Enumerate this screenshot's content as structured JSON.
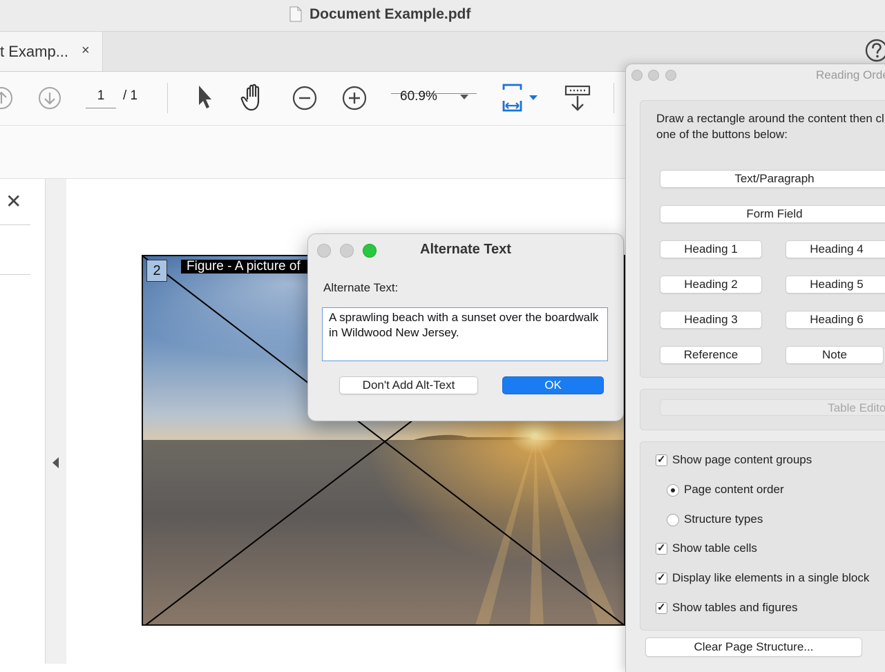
{
  "window": {
    "title": "Document Example.pdf"
  },
  "tab": {
    "label": "t Examp...",
    "close": "×"
  },
  "toolbar": {
    "page_current": "1",
    "page_total": "/ 1",
    "zoom": "60.9%"
  },
  "left_panel": {
    "close": "✕"
  },
  "figure": {
    "number": "2",
    "label": "Figure - A picture of"
  },
  "alt_dialog": {
    "title": "Alternate Text",
    "label": "Alternate Text:",
    "text": "A sprawling beach with a sunset over the boardwalk in Wildwood New Jersey.",
    "dont_add_button": "Don't Add Alt-Text",
    "ok_button": "OK"
  },
  "reading_order": {
    "title": "Reading Order",
    "instructions": "Draw a rectangle around the content then click one of the buttons below:",
    "buttons": {
      "text_paragraph": "Text/Paragraph",
      "form_field": "Form Field",
      "heading1": "Heading 1",
      "heading2": "Heading 2",
      "heading3": "Heading 3",
      "heading4": "Heading 4",
      "heading5": "Heading 5",
      "heading6": "Heading 6",
      "reference": "Reference",
      "note": "Note",
      "table_editor": "Table Editor",
      "clear_structure": "Clear Page Structure..."
    },
    "options": {
      "show_content_groups": "Show page content groups",
      "page_content_order": "Page content order",
      "structure_types": "Structure types",
      "show_table_cells": "Show table cells",
      "display_like_elements": "Display like elements in a single block",
      "show_tables_figures": "Show tables and figures"
    }
  },
  "colors": {
    "accent": "#1a7cf2",
    "traffic_red": "#ff5f57",
    "traffic_green": "#28c840",
    "figure_number_bg": "#a7c4e4"
  }
}
